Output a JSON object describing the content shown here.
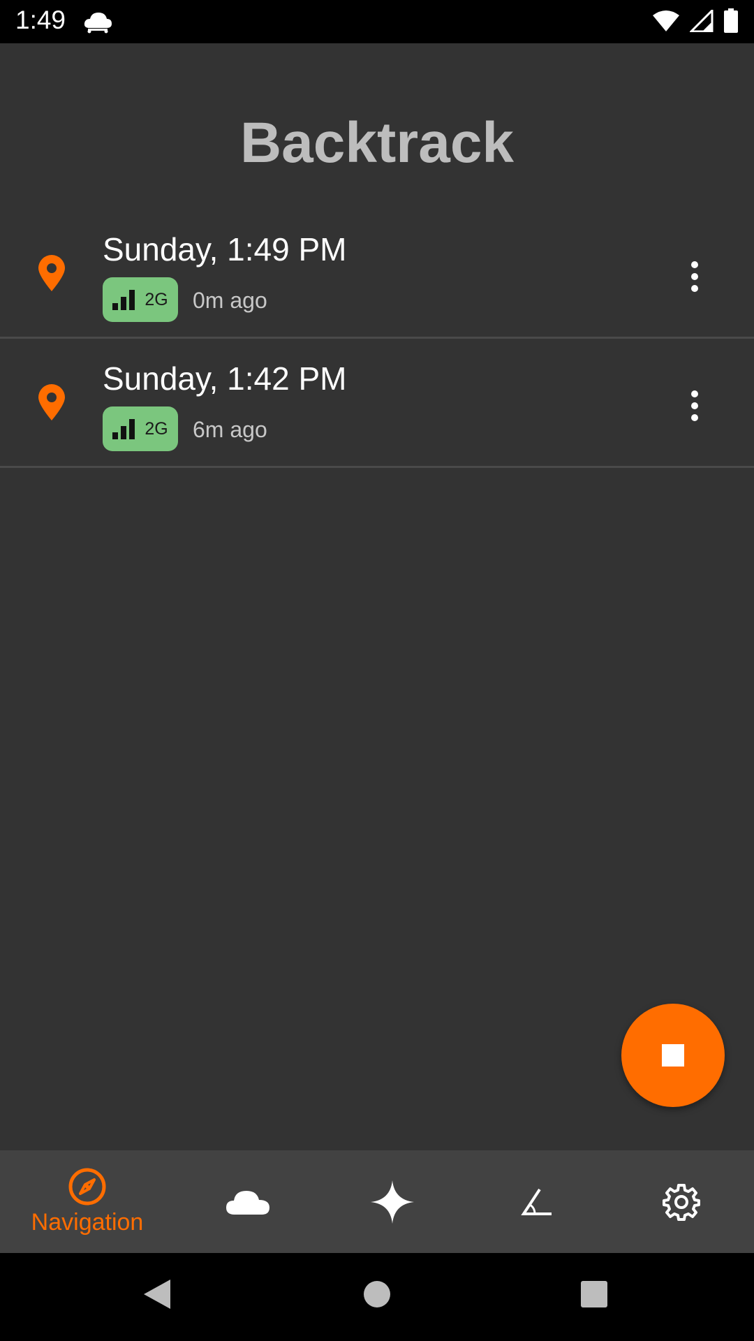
{
  "status_bar": {
    "time": "1:49"
  },
  "app": {
    "title": "Backtrack"
  },
  "entries": [
    {
      "when": "Sunday, 1:49 PM",
      "network": "2G",
      "ago": "0m ago"
    },
    {
      "when": "Sunday, 1:42 PM",
      "network": "2G",
      "ago": "6m ago"
    }
  ],
  "bottom_nav": {
    "items": [
      {
        "icon": "compass-icon",
        "label": "Navigation",
        "active": true
      },
      {
        "icon": "cloud-icon",
        "active": false
      },
      {
        "icon": "sparkle-icon",
        "active": false
      },
      {
        "icon": "angle-icon",
        "active": false
      },
      {
        "icon": "gear-icon",
        "active": false
      }
    ]
  },
  "colors": {
    "accent": "#ff6d00",
    "badge": "#7bc67e",
    "background": "#333333",
    "nav": "#424242"
  }
}
